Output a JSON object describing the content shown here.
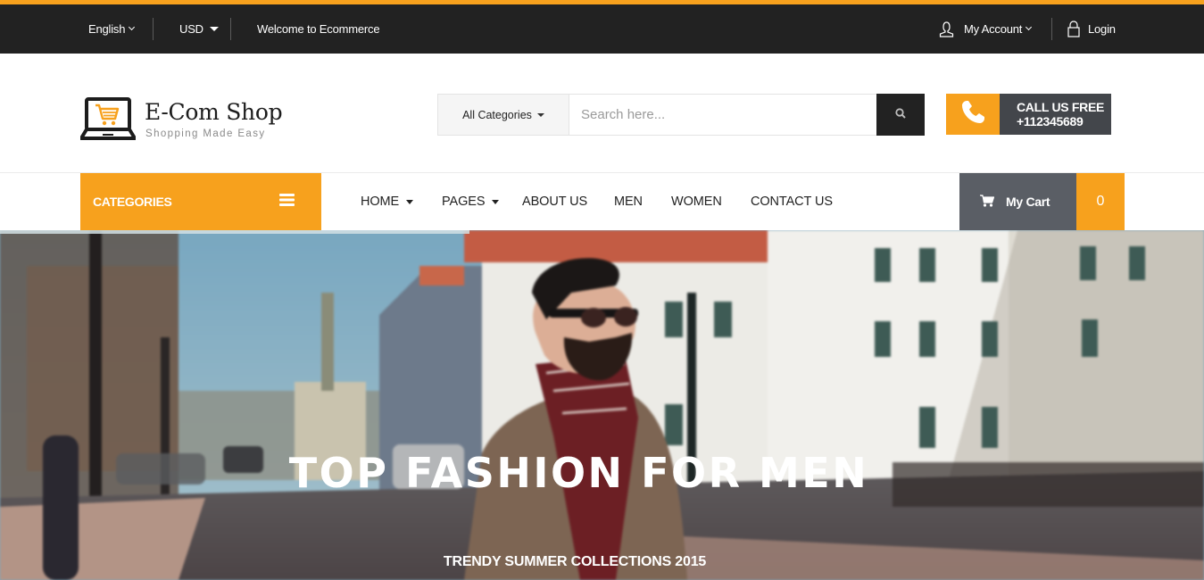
{
  "colors": {
    "accent": "#f7a11d",
    "topbar_bg": "#222222",
    "callus_bg": "#43464b",
    "cart_bg": "#5a5e65"
  },
  "topbar": {
    "language": "English",
    "currency": "USD",
    "welcome": "Welcome to Ecommerce",
    "account_label": "My Account",
    "login_label": "Login",
    "icons": {
      "language_caret": "chevron-down-icon",
      "currency_caret": "caret-down-icon",
      "account": "user-icon",
      "login": "lock-icon"
    }
  },
  "header": {
    "logo_icon": "laptop-cart-icon",
    "site_title": "E-Com Shop",
    "tagline": "Shopping Made Easy",
    "search": {
      "category_selected": "All Categories",
      "placeholder": "Search here...",
      "value": "",
      "button_icon": "search-icon"
    },
    "call": {
      "icon": "phone-icon",
      "label": "CALL US FREE",
      "number": "+112345689"
    }
  },
  "nav": {
    "categories_label": "CATEGORIES",
    "categories_icon": "hamburger-menu-icon",
    "items": [
      {
        "label": "HOME",
        "has_dropdown": true
      },
      {
        "label": "PAGES",
        "has_dropdown": true
      },
      {
        "label": "ABOUT US",
        "has_dropdown": false
      },
      {
        "label": "MEN",
        "has_dropdown": false
      },
      {
        "label": "WOMEN",
        "has_dropdown": false
      },
      {
        "label": "CONTACT US",
        "has_dropdown": false
      }
    ],
    "cart": {
      "icon": "cart-icon",
      "label": "My Cart",
      "count": "0"
    }
  },
  "hero": {
    "title": "TOP FASHION FOR MEN",
    "subtitle": "TRENDY SUMMER COLLECTIONS 2015",
    "image_description": "Bearded man in sunglasses, brown coat and plaid scarf on a city street",
    "slider_progress_percent": 39
  }
}
